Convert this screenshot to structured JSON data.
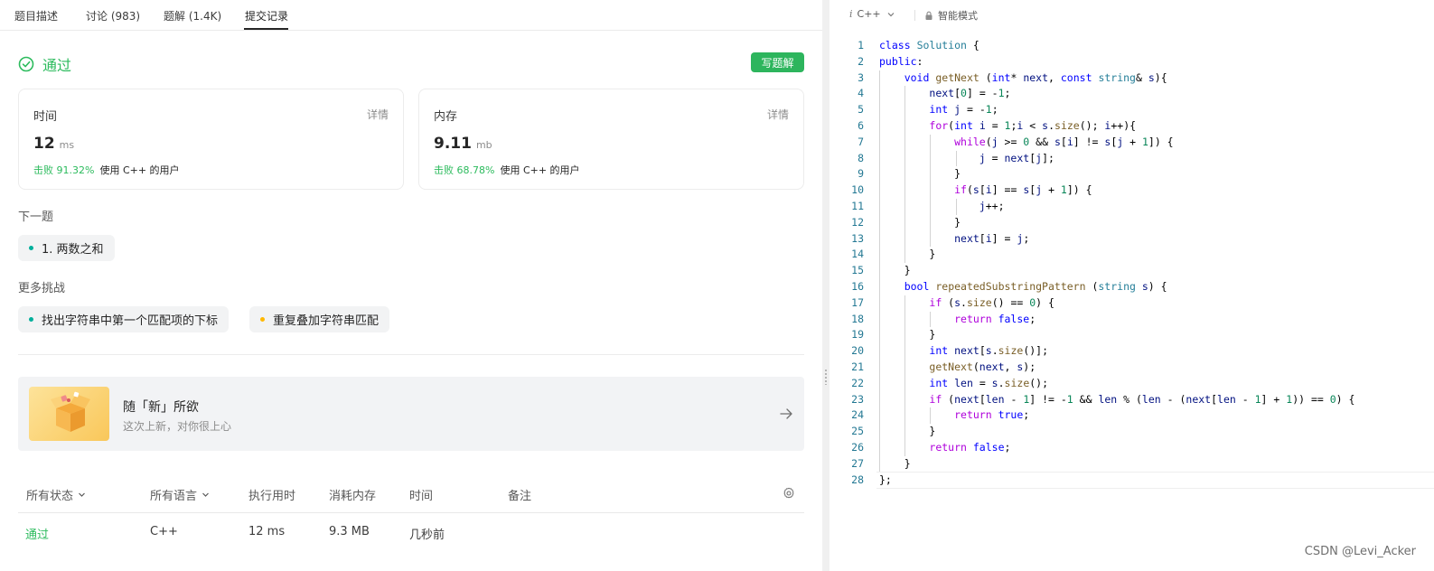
{
  "tabs": [
    {
      "label": "题目描述"
    },
    {
      "label": "讨论 (983)"
    },
    {
      "label": "题解 (1.4K)"
    },
    {
      "label": "提交记录"
    }
  ],
  "result": {
    "status": "通过",
    "write_solution": "写题解"
  },
  "cards": {
    "time": {
      "title": "时间",
      "detail": "详情",
      "value": "12",
      "unit": "ms",
      "beat_pct": "击败 91.32%",
      "beat_text": "使用 C++ 的用户"
    },
    "memory": {
      "title": "内存",
      "detail": "详情",
      "value": "9.11",
      "unit": "mb",
      "beat_pct": "击败 68.78%",
      "beat_text": "使用 C++ 的用户"
    }
  },
  "next": {
    "label": "下一题",
    "item": "1. 两数之和"
  },
  "more": {
    "label": "更多挑战",
    "items": [
      "找出字符串中第一个匹配项的下标",
      "重复叠加字符串匹配"
    ]
  },
  "colors": {
    "easy": "#00af9b",
    "medium": "#ffb800",
    "accepted": "#2cbb5d"
  },
  "banner": {
    "title": "随「新」所欲",
    "subtitle": "这次上新，对你很上心"
  },
  "table": {
    "headers": [
      "所有状态",
      "所有语言",
      "执行用时",
      "消耗内存",
      "时间",
      "备注"
    ],
    "row": [
      "通过",
      "C++",
      "12 ms",
      "9.3 MB",
      "几秒前",
      ""
    ]
  },
  "editor": {
    "lang_icon": "i",
    "language": "C++",
    "mode": "智能模式"
  },
  "code_lines": [
    "class Solution {",
    "public:",
    "    void getNext (int* next, const string& s){",
    "        next[0] = -1;",
    "        int j = -1;",
    "        for(int i = 1;i < s.size(); i++){",
    "            while(j >= 0 && s[i] != s[j + 1]) {",
    "                j = next[j];",
    "            }",
    "            if(s[i] == s[j + 1]) {",
    "                j++;",
    "            }",
    "            next[i] = j;",
    "        }",
    "    }",
    "    bool repeatedSubstringPattern (string s) {",
    "        if (s.size() == 0) {",
    "            return false;",
    "        }",
    "        int next[s.size()];",
    "        getNext(next, s);",
    "        int len = s.size();",
    "        if (next[len - 1] != -1 && len % (len - (next[len - 1] + 1)) == 0) {",
    "            return true;",
    "        }",
    "        return false;",
    "    }",
    "};"
  ],
  "watermark": "CSDN @Levi_Acker"
}
